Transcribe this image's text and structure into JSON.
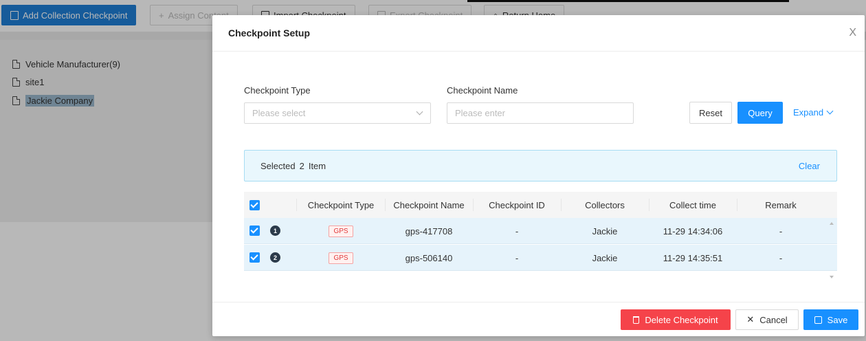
{
  "background": {
    "toolbar": {
      "add_collection": "Add Collection Checkpoint",
      "assign_content": "Assign Content",
      "import_checkpoint": "Import Checkpoint",
      "export_checkpoint": "Export Checkpoint",
      "return_home": "Return Home"
    },
    "tree": [
      {
        "label": "Vehicle Manufacturer(9)"
      },
      {
        "label": "site1"
      },
      {
        "label": "Jackie Company"
      }
    ]
  },
  "modal": {
    "title": "Checkpoint Setup",
    "close": "X",
    "form": {
      "type_label": "Checkpoint Type",
      "type_placeholder": "Please select",
      "name_label": "Checkpoint Name",
      "name_placeholder": "Please enter",
      "reset": "Reset",
      "query": "Query",
      "expand": "Expand"
    },
    "selection": {
      "prefix": "Selected",
      "count": "2",
      "suffix": "Item",
      "clear": "Clear"
    },
    "table": {
      "columns": [
        "Checkpoint Type",
        "Checkpoint Name",
        "Checkpoint ID",
        "Collectors",
        "Collect time",
        "Remark"
      ],
      "rows": [
        {
          "index": "1",
          "type": "GPS",
          "name": "gps-417708",
          "id": "-",
          "collector": "Jackie",
          "time": "11-29 14:34:06",
          "remark": "-"
        },
        {
          "index": "2",
          "type": "GPS",
          "name": "gps-506140",
          "id": "-",
          "collector": "Jackie",
          "time": "11-29 14:35:51",
          "remark": "-"
        }
      ]
    },
    "footer": {
      "delete": "Delete Checkpoint",
      "cancel": "Cancel",
      "save": "Save"
    }
  },
  "colors": {
    "primary": "#1890ff",
    "danger": "#f5434a",
    "selected_row": "#e6f3fb"
  }
}
